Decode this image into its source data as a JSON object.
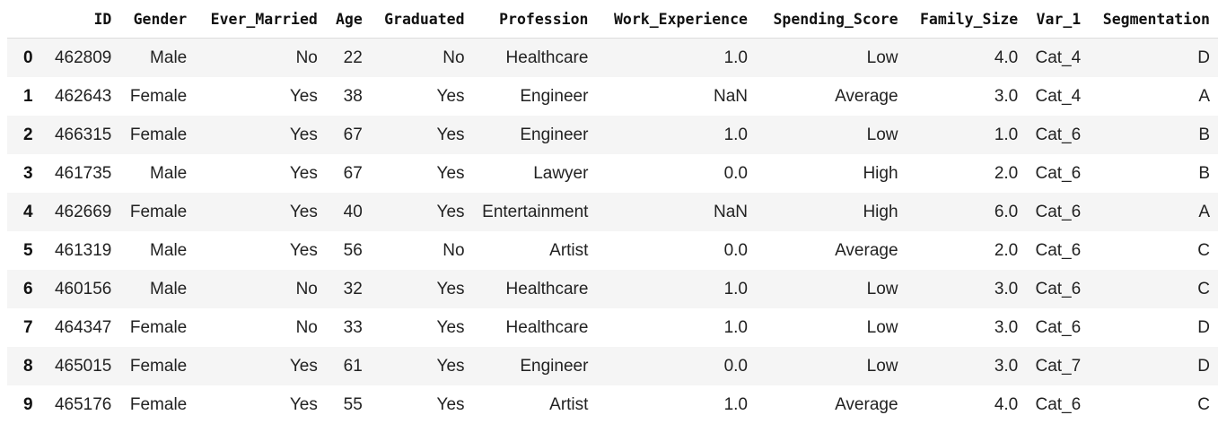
{
  "table": {
    "index_header": "",
    "columns": [
      "ID",
      "Gender",
      "Ever_Married",
      "Age",
      "Graduated",
      "Profession",
      "Work_Experience",
      "Spending_Score",
      "Family_Size",
      "Var_1",
      "Segmentation"
    ],
    "rows": [
      {
        "index": "0",
        "cells": [
          "462809",
          "Male",
          "No",
          "22",
          "No",
          "Healthcare",
          "1.0",
          "Low",
          "4.0",
          "Cat_4",
          "D"
        ]
      },
      {
        "index": "1",
        "cells": [
          "462643",
          "Female",
          "Yes",
          "38",
          "Yes",
          "Engineer",
          "NaN",
          "Average",
          "3.0",
          "Cat_4",
          "A"
        ]
      },
      {
        "index": "2",
        "cells": [
          "466315",
          "Female",
          "Yes",
          "67",
          "Yes",
          "Engineer",
          "1.0",
          "Low",
          "1.0",
          "Cat_6",
          "B"
        ]
      },
      {
        "index": "3",
        "cells": [
          "461735",
          "Male",
          "Yes",
          "67",
          "Yes",
          "Lawyer",
          "0.0",
          "High",
          "2.0",
          "Cat_6",
          "B"
        ]
      },
      {
        "index": "4",
        "cells": [
          "462669",
          "Female",
          "Yes",
          "40",
          "Yes",
          "Entertainment",
          "NaN",
          "High",
          "6.0",
          "Cat_6",
          "A"
        ]
      },
      {
        "index": "5",
        "cells": [
          "461319",
          "Male",
          "Yes",
          "56",
          "No",
          "Artist",
          "0.0",
          "Average",
          "2.0",
          "Cat_6",
          "C"
        ]
      },
      {
        "index": "6",
        "cells": [
          "460156",
          "Male",
          "No",
          "32",
          "Yes",
          "Healthcare",
          "1.0",
          "Low",
          "3.0",
          "Cat_6",
          "C"
        ]
      },
      {
        "index": "7",
        "cells": [
          "464347",
          "Female",
          "No",
          "33",
          "Yes",
          "Healthcare",
          "1.0",
          "Low",
          "3.0",
          "Cat_6",
          "D"
        ]
      },
      {
        "index": "8",
        "cells": [
          "465015",
          "Female",
          "Yes",
          "61",
          "Yes",
          "Engineer",
          "0.0",
          "Low",
          "3.0",
          "Cat_7",
          "D"
        ]
      },
      {
        "index": "9",
        "cells": [
          "465176",
          "Female",
          "Yes",
          "55",
          "Yes",
          "Artist",
          "1.0",
          "Average",
          "4.0",
          "Cat_6",
          "C"
        ]
      }
    ]
  },
  "colors": {
    "stripe": "#f5f5f5",
    "text": "#222222"
  }
}
